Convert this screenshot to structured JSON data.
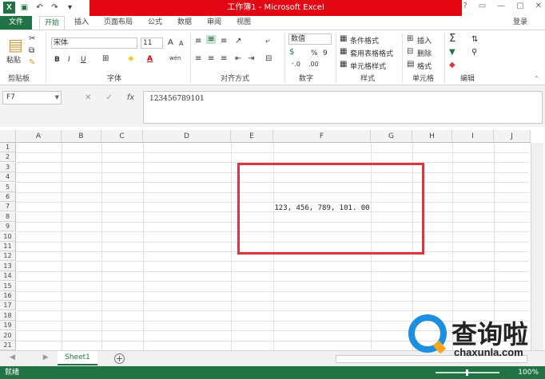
{
  "window": {
    "title": "工作簿1 - Microsoft Excel",
    "logo": "X",
    "controls": [
      "?",
      "▭",
      "—",
      "▢",
      "✕"
    ]
  },
  "qat": {
    "save_icon": "▣",
    "undo_icon": "↶",
    "redo_icon": "↷",
    "customize_icon": "▾"
  },
  "tabs": [
    "文件",
    "开始",
    "插入",
    "页面布局",
    "公式",
    "数据",
    "审阅",
    "视图"
  ],
  "login": "登录",
  "ribbon": {
    "clipboard": {
      "label": "剪贴板",
      "paste": "粘贴"
    },
    "font": {
      "label": "字体",
      "name": "宋体",
      "size": "11",
      "grow": "A",
      "shrink": "A",
      "bold": "B",
      "italic": "I",
      "underline": "U",
      "color_letter": "A",
      "pinyin": "wén"
    },
    "alignment": {
      "label": "对齐方式"
    },
    "number": {
      "label": "数字",
      "format": "数值",
      "percent": "%",
      "comma": "9"
    },
    "styles": {
      "label": "样式",
      "conditional": "条件格式",
      "table": "套用表格格式",
      "cell": "单元格样式"
    },
    "cells": {
      "label": "单元格",
      "insert": "插入",
      "delete": "删除",
      "format": "格式"
    },
    "editing": {
      "label": "编辑",
      "sum": "Σ"
    }
  },
  "formula_bar": {
    "name_box": "F7",
    "cancel": "✕",
    "enter": "✓",
    "fx": "fx",
    "content": "123456789101"
  },
  "columns": [
    "A",
    "B",
    "C",
    "D",
    "E",
    "F",
    "G",
    "H",
    "I",
    "J"
  ],
  "rows": [
    "1",
    "2",
    "3",
    "4",
    "5",
    "6",
    "7",
    "8",
    "9",
    "10",
    "11",
    "12",
    "13",
    "14",
    "15",
    "16",
    "17",
    "18",
    "19",
    "20",
    "21"
  ],
  "cell_f7": "123, 456, 789, 101. 00",
  "sheets": {
    "active": "Sheet1",
    "add": "+",
    "nav": "◀ ▶"
  },
  "status": {
    "ready": "就绪",
    "zoom": "100%"
  },
  "watermark": {
    "cn": "查询啦",
    "en": "chaxunla.com"
  }
}
